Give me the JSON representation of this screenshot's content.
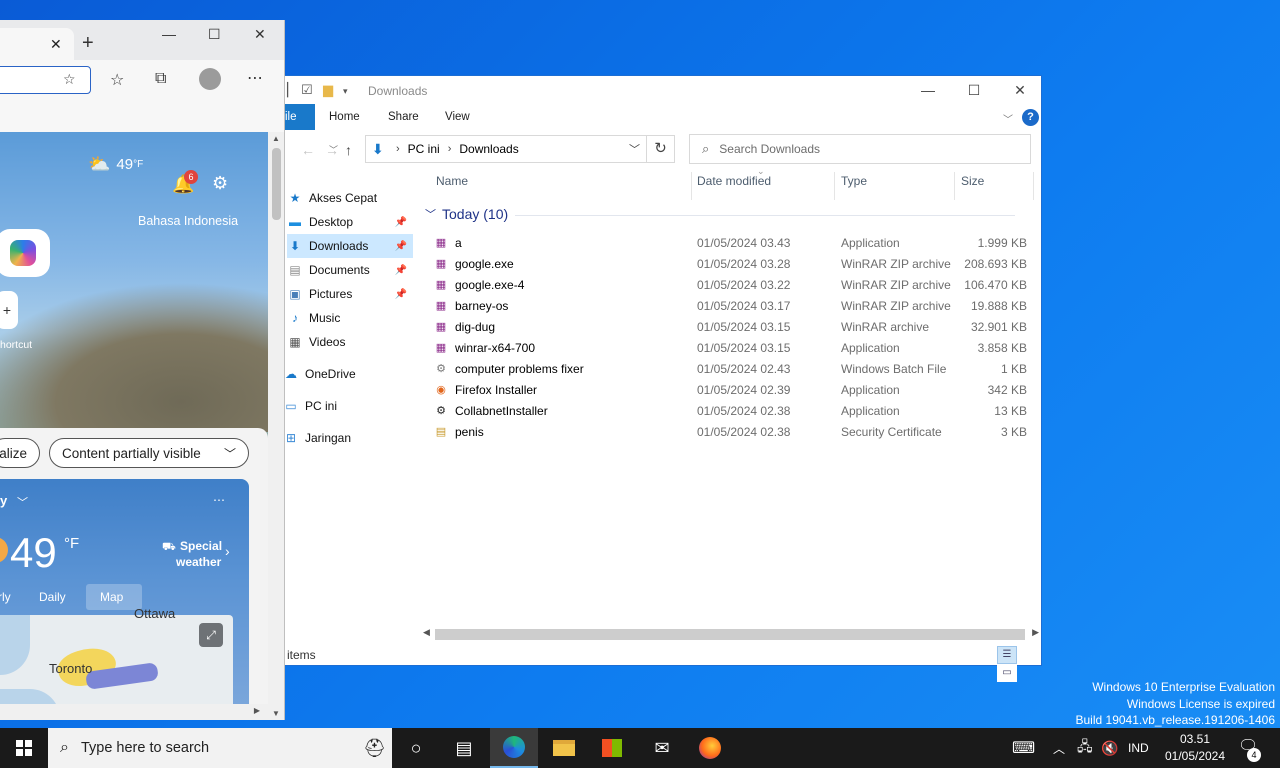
{
  "desktop": {
    "watermark": [
      "Windows 10 Enterprise Evaluation",
      "Windows License is expired",
      "Build 19041.vb_release.191206-1406"
    ]
  },
  "explorer": {
    "title": "Downloads",
    "ribbon_tabs": [
      "ile",
      "Home",
      "Share",
      "View"
    ],
    "breadcrumb": [
      "PC ini",
      "Downloads"
    ],
    "search_placeholder": "Search Downloads",
    "nav": [
      {
        "label": "Akses Cepat",
        "icon": "star-icon",
        "pinned": false
      },
      {
        "label": "Desktop",
        "icon": "desktop-icon",
        "pinned": true
      },
      {
        "label": "Downloads",
        "icon": "download-icon",
        "pinned": true,
        "selected": true
      },
      {
        "label": "Documents",
        "icon": "document-icon",
        "pinned": true
      },
      {
        "label": "Pictures",
        "icon": "picture-icon",
        "pinned": true
      },
      {
        "label": "Music",
        "icon": "music-icon",
        "pinned": false
      },
      {
        "label": "Videos",
        "icon": "video-icon",
        "pinned": false
      },
      {
        "label": "OneDrive",
        "icon": "cloud-icon",
        "pinned": false
      },
      {
        "label": "PC ini",
        "icon": "computer-icon",
        "pinned": false
      },
      {
        "label": "Jaringan",
        "icon": "network-icon",
        "pinned": false
      }
    ],
    "columns": [
      "Name",
      "Date modified",
      "Type",
      "Size"
    ],
    "group_label": "Today (10)",
    "files": [
      {
        "name": "a",
        "date": "01/05/2024 03.43",
        "type": "Application",
        "size": "1.999 KB",
        "icon": "winrar-icon"
      },
      {
        "name": "google.exe",
        "date": "01/05/2024 03.28",
        "type": "WinRAR ZIP archive",
        "size": "208.693 KB",
        "icon": "winrar-icon"
      },
      {
        "name": "google.exe-4",
        "date": "01/05/2024 03.22",
        "type": "WinRAR ZIP archive",
        "size": "106.470 KB",
        "icon": "winrar-icon"
      },
      {
        "name": "barney-os",
        "date": "01/05/2024 03.17",
        "type": "WinRAR ZIP archive",
        "size": "19.888 KB",
        "icon": "winrar-icon"
      },
      {
        "name": "dig-dug",
        "date": "01/05/2024 03.15",
        "type": "WinRAR archive",
        "size": "32.901 KB",
        "icon": "winrar-icon"
      },
      {
        "name": "winrar-x64-700",
        "date": "01/05/2024 03.15",
        "type": "Application",
        "size": "3.858 KB",
        "icon": "winrar-icon"
      },
      {
        "name": "computer problems fixer",
        "date": "01/05/2024 02.43",
        "type": "Windows Batch File",
        "size": "1 KB",
        "icon": "batch-file-icon"
      },
      {
        "name": "Firefox Installer",
        "date": "01/05/2024 02.39",
        "type": "Application",
        "size": "342 KB",
        "icon": "installer-icon"
      },
      {
        "name": "CollabnetInstaller",
        "date": "01/05/2024 02.38",
        "type": "Application",
        "size": "13 KB",
        "icon": "gear-app-icon"
      },
      {
        "name": "penis",
        "date": "01/05/2024 02.38",
        "type": "Security Certificate",
        "size": "3 KB",
        "icon": "certificate-icon"
      }
    ],
    "status": "items"
  },
  "edge": {
    "weather_temp": "49",
    "weather_unit": "°F",
    "notifications": "6",
    "language": "Bahasa Indonesia",
    "shortcut_label": "hortcut",
    "personalize_label": "alize",
    "content_visibility": "Content partially visible",
    "card_title": "y",
    "big_temp": "49",
    "big_unit": "°F",
    "special_weather": [
      "Special",
      "weather"
    ],
    "tabs": [
      "rly",
      "Daily",
      "Map"
    ],
    "map_cities": [
      "Ottawa",
      "Toronto"
    ]
  },
  "taskbar": {
    "search_placeholder": "Type here to search",
    "lang": "IND",
    "time": "03.51",
    "date": "01/05/2024",
    "notification_count": "4"
  }
}
